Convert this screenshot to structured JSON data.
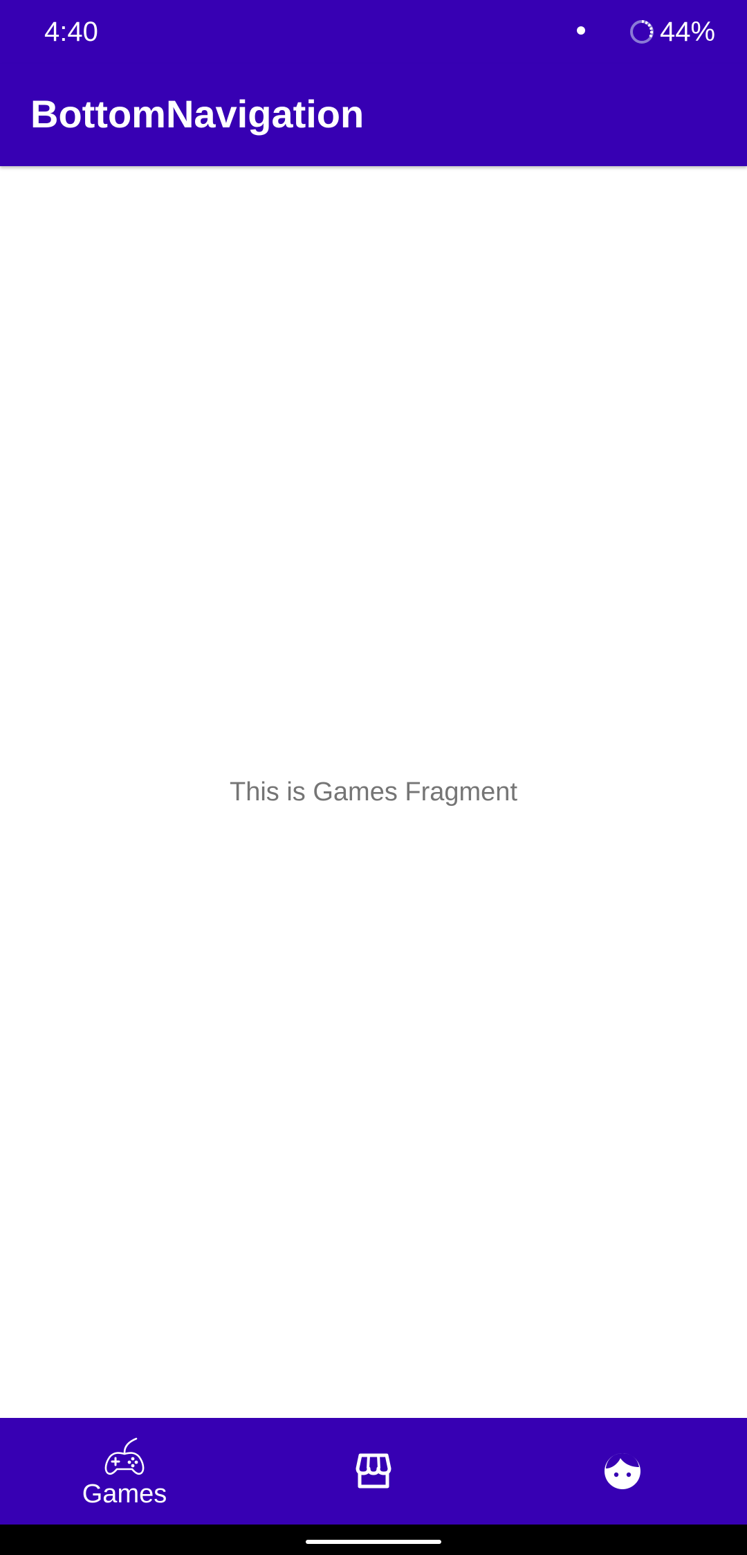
{
  "status_bar": {
    "time": "4:40",
    "battery": "44%"
  },
  "app_bar": {
    "title": "BottomNavigation"
  },
  "content": {
    "message": "This is Games Fragment"
  },
  "bottom_nav": {
    "items": [
      {
        "label": "Games",
        "icon": "gamepad-icon",
        "selected": true
      },
      {
        "label": "",
        "icon": "store-icon",
        "selected": false
      },
      {
        "label": "",
        "icon": "face-icon",
        "selected": false
      }
    ]
  },
  "colors": {
    "primary": "#3700b3",
    "status_bar": "#3700b3",
    "on_primary": "#ffffff",
    "body_text": "#757575"
  }
}
